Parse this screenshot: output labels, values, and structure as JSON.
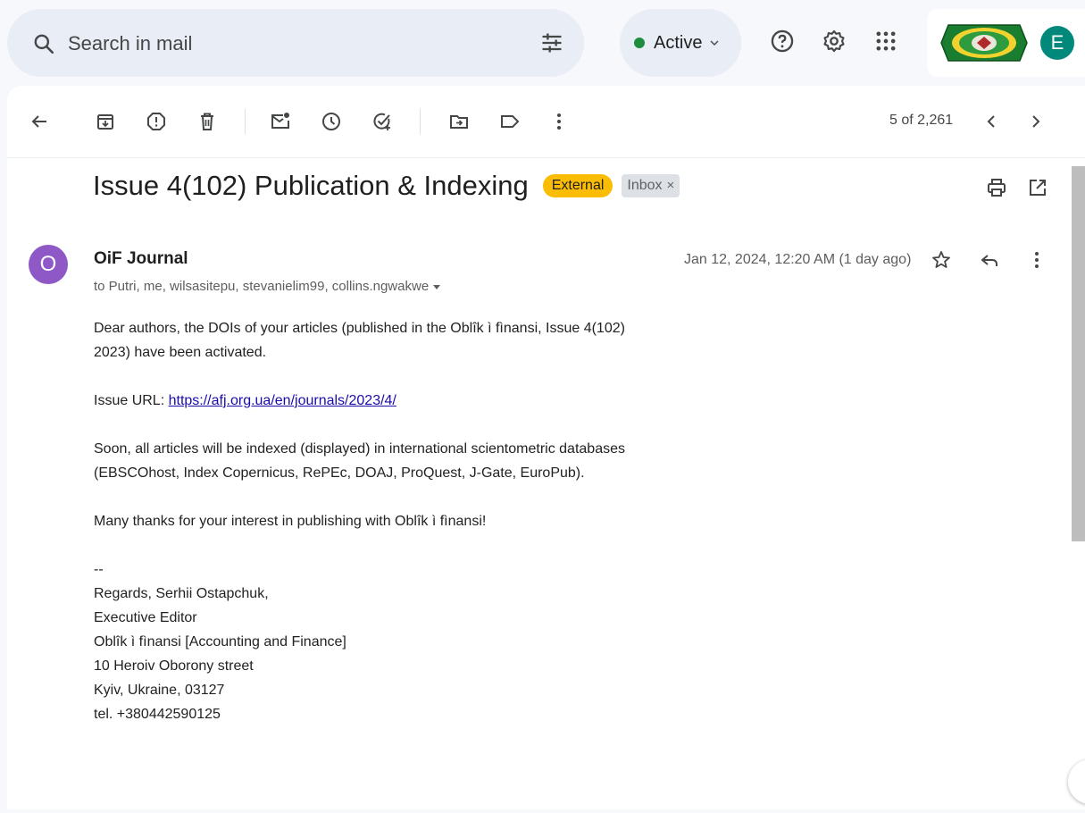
{
  "search": {
    "placeholder": "Search in mail"
  },
  "status": {
    "label": "Active"
  },
  "toolbar": {
    "pager": "5 of 2,261"
  },
  "message": {
    "subject": "Issue 4(102) Publication & Indexing",
    "labels": {
      "external": "External",
      "inbox": "Inbox",
      "inbox_remove": "×"
    },
    "sender": {
      "name": "OiF Journal",
      "initial": "O"
    },
    "recipients": "to Putri, me, wilsasitepu, stevanielim99, collins.ngwakwe",
    "date": "Jan 12, 2024, 12:20 AM (1 day ago)",
    "body": {
      "para1": "Dear authors, the DOIs of your articles (published in the Oblîk ì fìnansi, Issue 4(102) 2023) have been activated.",
      "issue_url_label": "Issue URL: ",
      "issue_url": "https://afj.org.ua/en/journals/2023/4/",
      "para3": "Soon, all articles will be indexed (displayed) in international scientometric databases (EBSCOhost, Index Copernicus, RePEc, DOAJ, ProQuest, J-Gate, EuroPub).",
      "para4": "Many thanks for your interest in publishing with Oblîk ì fìnansi!",
      "signature": [
        "--",
        "Regards, Serhii Ostapchuk,",
        "Executive Editor",
        "Oblîk ì fìnansi [Accounting and Finance]",
        "10 Heroiv Oborony street",
        "Kyiv, Ukraine, 03127",
        "tel. +380442590125"
      ]
    }
  },
  "account": {
    "initial": "E",
    "avatar_color": "#00897b"
  },
  "colors": {
    "external_label": "#fbbc04",
    "sender_avatar": "#8e59c7",
    "active_dot": "#1e8e3e"
  },
  "icons": {
    "header": [
      "search-icon",
      "tune-icon",
      "help-icon",
      "settings-icon",
      "apps-icon"
    ],
    "toolbar": [
      "back-arrow-icon",
      "archive-icon",
      "report-spam-icon",
      "delete-icon",
      "mark-unread-icon",
      "snooze-icon",
      "add-task-icon",
      "move-to-icon",
      "label-icon",
      "more-vert-icon",
      "chevron-left-icon",
      "chevron-right-icon"
    ],
    "message": [
      "print-icon",
      "open-new-window-icon",
      "star-icon",
      "reply-icon",
      "more-vert-icon"
    ]
  }
}
